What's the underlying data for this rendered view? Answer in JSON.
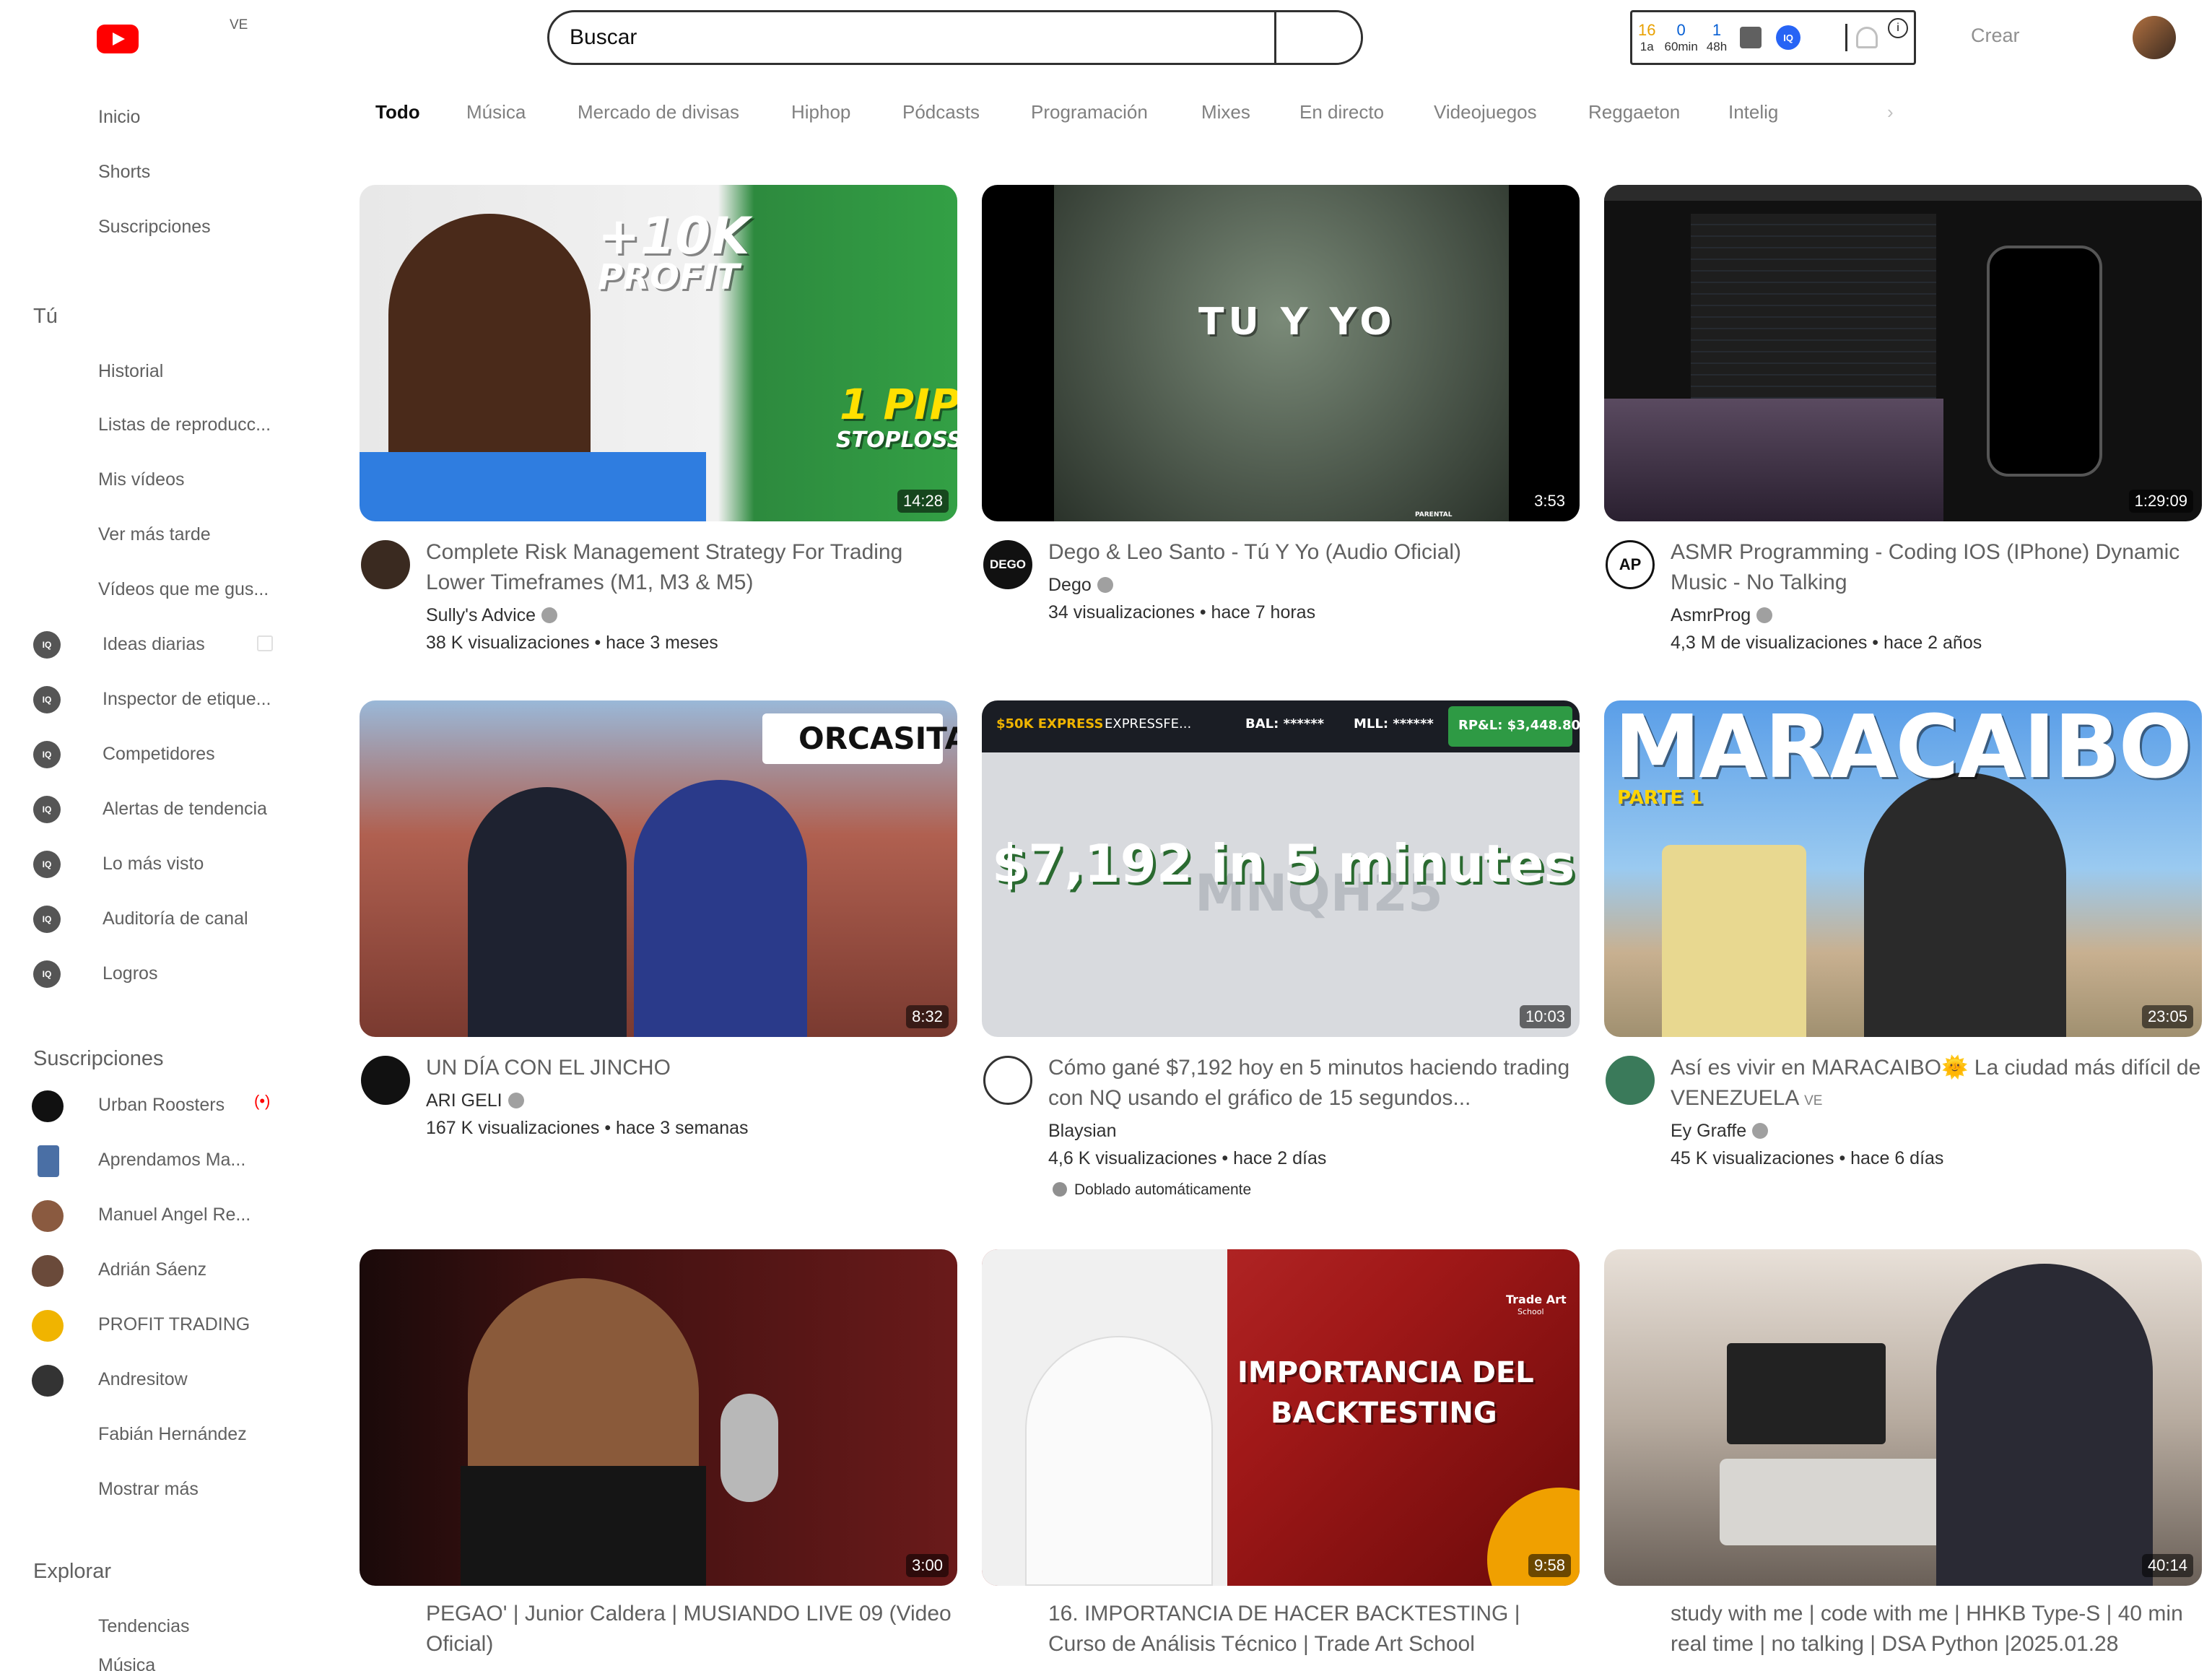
{
  "header": {
    "country_code": "VE",
    "search_placeholder": "Buscar",
    "create_label": "Crear",
    "stats": [
      {
        "value": "16",
        "label": "1a"
      },
      {
        "value": "0",
        "label": "60min"
      },
      {
        "value": "1",
        "label": "48h"
      }
    ],
    "badge": "IQ",
    "info": "i"
  },
  "sidebar": {
    "main": [
      "Inicio",
      "Shorts",
      "Suscripciones"
    ],
    "you_heading": "Tú",
    "you_items": [
      "Historial",
      "Listas de reproducc...",
      "Mis vídeos",
      "Ver más tarde",
      "Vídeos que me gus..."
    ],
    "tools": [
      "Ideas diarias",
      "Inspector de etique...",
      "Competidores",
      "Alertas de tendencia",
      "Lo más visto",
      "Auditoría de canal",
      "Logros"
    ],
    "tool_icon": "IQ",
    "subs_heading": "Suscripciones",
    "subscriptions": [
      "Urban Roosters",
      "Aprendamos Ma...",
      "Manuel Angel Re...",
      "Adrián Sáenz",
      "PROFIT TRADING",
      "Andresitow",
      "Fabián Hernández",
      "Mostrar más"
    ],
    "explore_heading": "Explorar",
    "explore": [
      "Tendencias",
      "Música"
    ],
    "live_icon": "(•)"
  },
  "chips": [
    "Todo",
    "Música",
    "Mercado de divisas",
    "Hiphop",
    "Pódcasts",
    "Programación",
    "Mixes",
    "En directo",
    "Videojuegos",
    "Reggaeton",
    "Intelig"
  ],
  "chip_arrow": "›",
  "videos": [
    {
      "title": "Complete Risk Management Strategy For Trading Lower Timeframes (M1, M3 & M5)",
      "channel": "Sully's Advice",
      "meta": "38 K visualizaciones • hace 3 meses",
      "duration": "14:28",
      "thumb_text": [
        "+10K",
        "PROFIT",
        "1 PIP",
        "STOPLOSS"
      ]
    },
    {
      "title": "Dego & Leo Santo - Tú Y Yo (Audio Oficial)",
      "channel": "Dego",
      "meta": "34 visualizaciones • hace 7 horas",
      "duration": "3:53",
      "thumb_text": [
        "TU Y YO",
        "PARENTAL"
      ],
      "avatar_text": "DEGO"
    },
    {
      "title": "ASMR Programming - Coding IOS (IPhone) Dynamic Music - No Talking",
      "channel": "AsmrProg",
      "meta": "4,3 M de visualizaciones • hace 2 años",
      "duration": "1:29:09",
      "avatar_text": "AP"
    },
    {
      "title": "UN DÍA CON EL JINCHO",
      "channel": "ARI GELI",
      "meta": "167 K visualizaciones • hace 3 semanas",
      "duration": "8:32",
      "thumb_text": [
        "ORCASITAS"
      ]
    },
    {
      "title": "Cómo gané $7,192 hoy en 5 minutos haciendo trading con NQ usando el gráfico de 15 segundos...",
      "channel": "Blaysian",
      "meta": "4,6 K visualizaciones • hace 2 días",
      "duration": "10:03",
      "dubbed": "Doblado automáticamente",
      "thumb_text": [
        "$50K EXPRESS",
        "EXPRESSFE...",
        "BAL: ******",
        "MLL: ******",
        "RP&L: $3,448.80",
        "$7,192 in 5 minutes!",
        "MNQH25"
      ]
    },
    {
      "title": "Así es vivir en MARACAIBO🌞 La ciudad más difícil de VENEZUELA",
      "title_badge": "VE",
      "channel": "Ey Graffe",
      "meta": "45 K visualizaciones • hace 6 días",
      "duration": "23:05",
      "thumb_text": [
        "MARACAIBO",
        "PARTE 1"
      ]
    },
    {
      "title": "PEGAO' | Junior Caldera | MUSIANDO LIVE 09 (Video Oficial)",
      "duration": "3:00"
    },
    {
      "title": "16. IMPORTANCIA DE HACER BACKTESTING | Curso de Análisis Técnico | Trade Art School",
      "duration": "9:58",
      "thumb_text": [
        "IMPORTANCIA DEL",
        "BACKTESTING",
        "Trade Art",
        "School"
      ]
    },
    {
      "title": "study with me | code with me | HHKB Type-S | 40 min real time | no talking | DSA Python |2025.01.28",
      "duration": "40:14"
    }
  ]
}
